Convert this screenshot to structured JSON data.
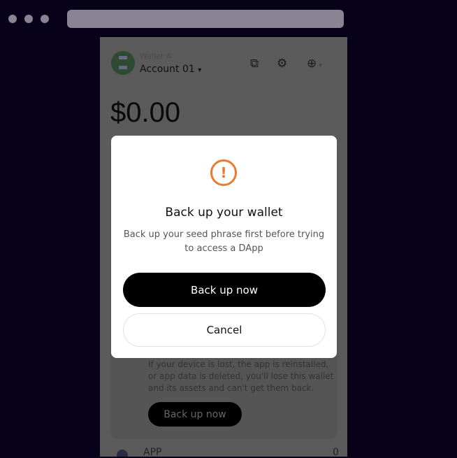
{
  "browser": {
    "dots": 3
  },
  "header": {
    "wallet_name": "Wallet A",
    "account": "Account 01",
    "account_caret": "▾",
    "icons": [
      "copy-icon",
      "gear-icon",
      "network-icon"
    ]
  },
  "balance": "$0.00",
  "backup_card": {
    "text": "If your device is lost, the app is reinstalled, or app data is deleted, you'll lose this wallet and its assets and can't get them back.",
    "button": "Back up now"
  },
  "list": {
    "label": "APP",
    "value": "0"
  },
  "modal": {
    "icon": "!",
    "title": "Back up your wallet",
    "subtitle": "Back up your seed phrase first before trying to access a DApp",
    "primary": "Back up now",
    "cancel": "Cancel",
    "accent": "#ea7a2c"
  }
}
